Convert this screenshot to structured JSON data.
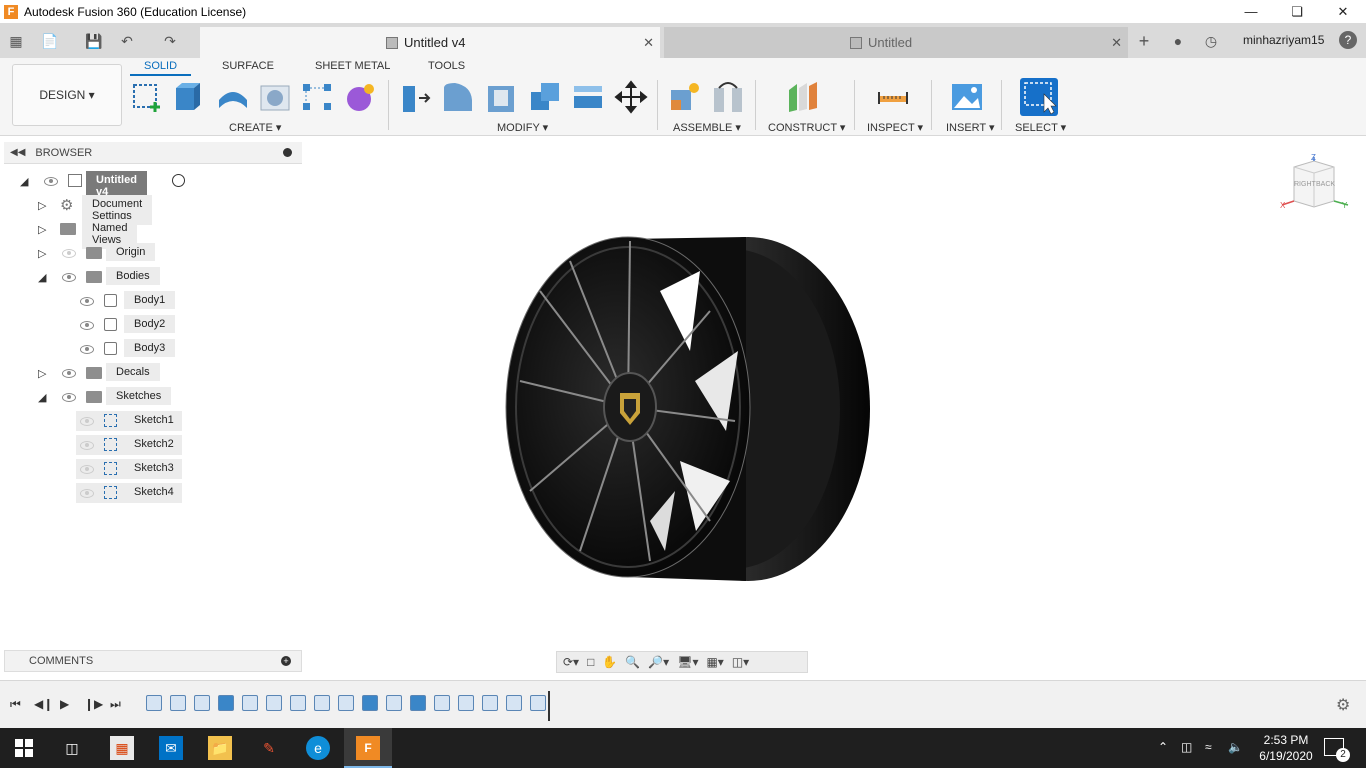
{
  "window": {
    "title": "Autodesk Fusion 360 (Education License)",
    "app_icon_letter": "F"
  },
  "tabs": [
    {
      "label": "Untitled v4",
      "active": true
    },
    {
      "label": "Untitled",
      "active": false
    }
  ],
  "user": {
    "name": "minhazriyam15",
    "help": "?"
  },
  "workspace": {
    "label": "DESIGN ▾"
  },
  "toolbar_tabs": [
    "SOLID",
    "SURFACE",
    "SHEET METAL",
    "TOOLS"
  ],
  "groups": {
    "create": "CREATE ▾",
    "modify": "MODIFY ▾",
    "assemble": "ASSEMBLE ▾",
    "construct": "CONSTRUCT ▾",
    "inspect": "INSPECT ▾",
    "insert": "INSERT ▾",
    "select": "SELECT ▾"
  },
  "browser": {
    "header": "BROWSER",
    "root": "Untitled v4",
    "items": [
      {
        "label": "Document Settings"
      },
      {
        "label": "Named Views"
      },
      {
        "label": "Origin"
      },
      {
        "label": "Bodies"
      },
      {
        "label": "Body1"
      },
      {
        "label": "Body2"
      },
      {
        "label": "Body3"
      },
      {
        "label": "Decals"
      },
      {
        "label": "Sketches"
      },
      {
        "label": "Sketch1"
      },
      {
        "label": "Sketch2"
      },
      {
        "label": "Sketch3"
      },
      {
        "label": "Sketch4"
      }
    ]
  },
  "comments": {
    "label": "COMMENTS"
  },
  "viewcube": {
    "right": "RIGHT",
    "back": "BACK",
    "x": "X",
    "y": "Y",
    "z": "Z"
  },
  "taskbar": {
    "time": "2:53 PM",
    "date": "6/19/2020",
    "notifications": "2"
  },
  "colors": {
    "accent": "#0a6ebd",
    "title_bar": "#ffffff",
    "tab_bar": "#dadada",
    "taskbar": "#1f1f1f"
  }
}
